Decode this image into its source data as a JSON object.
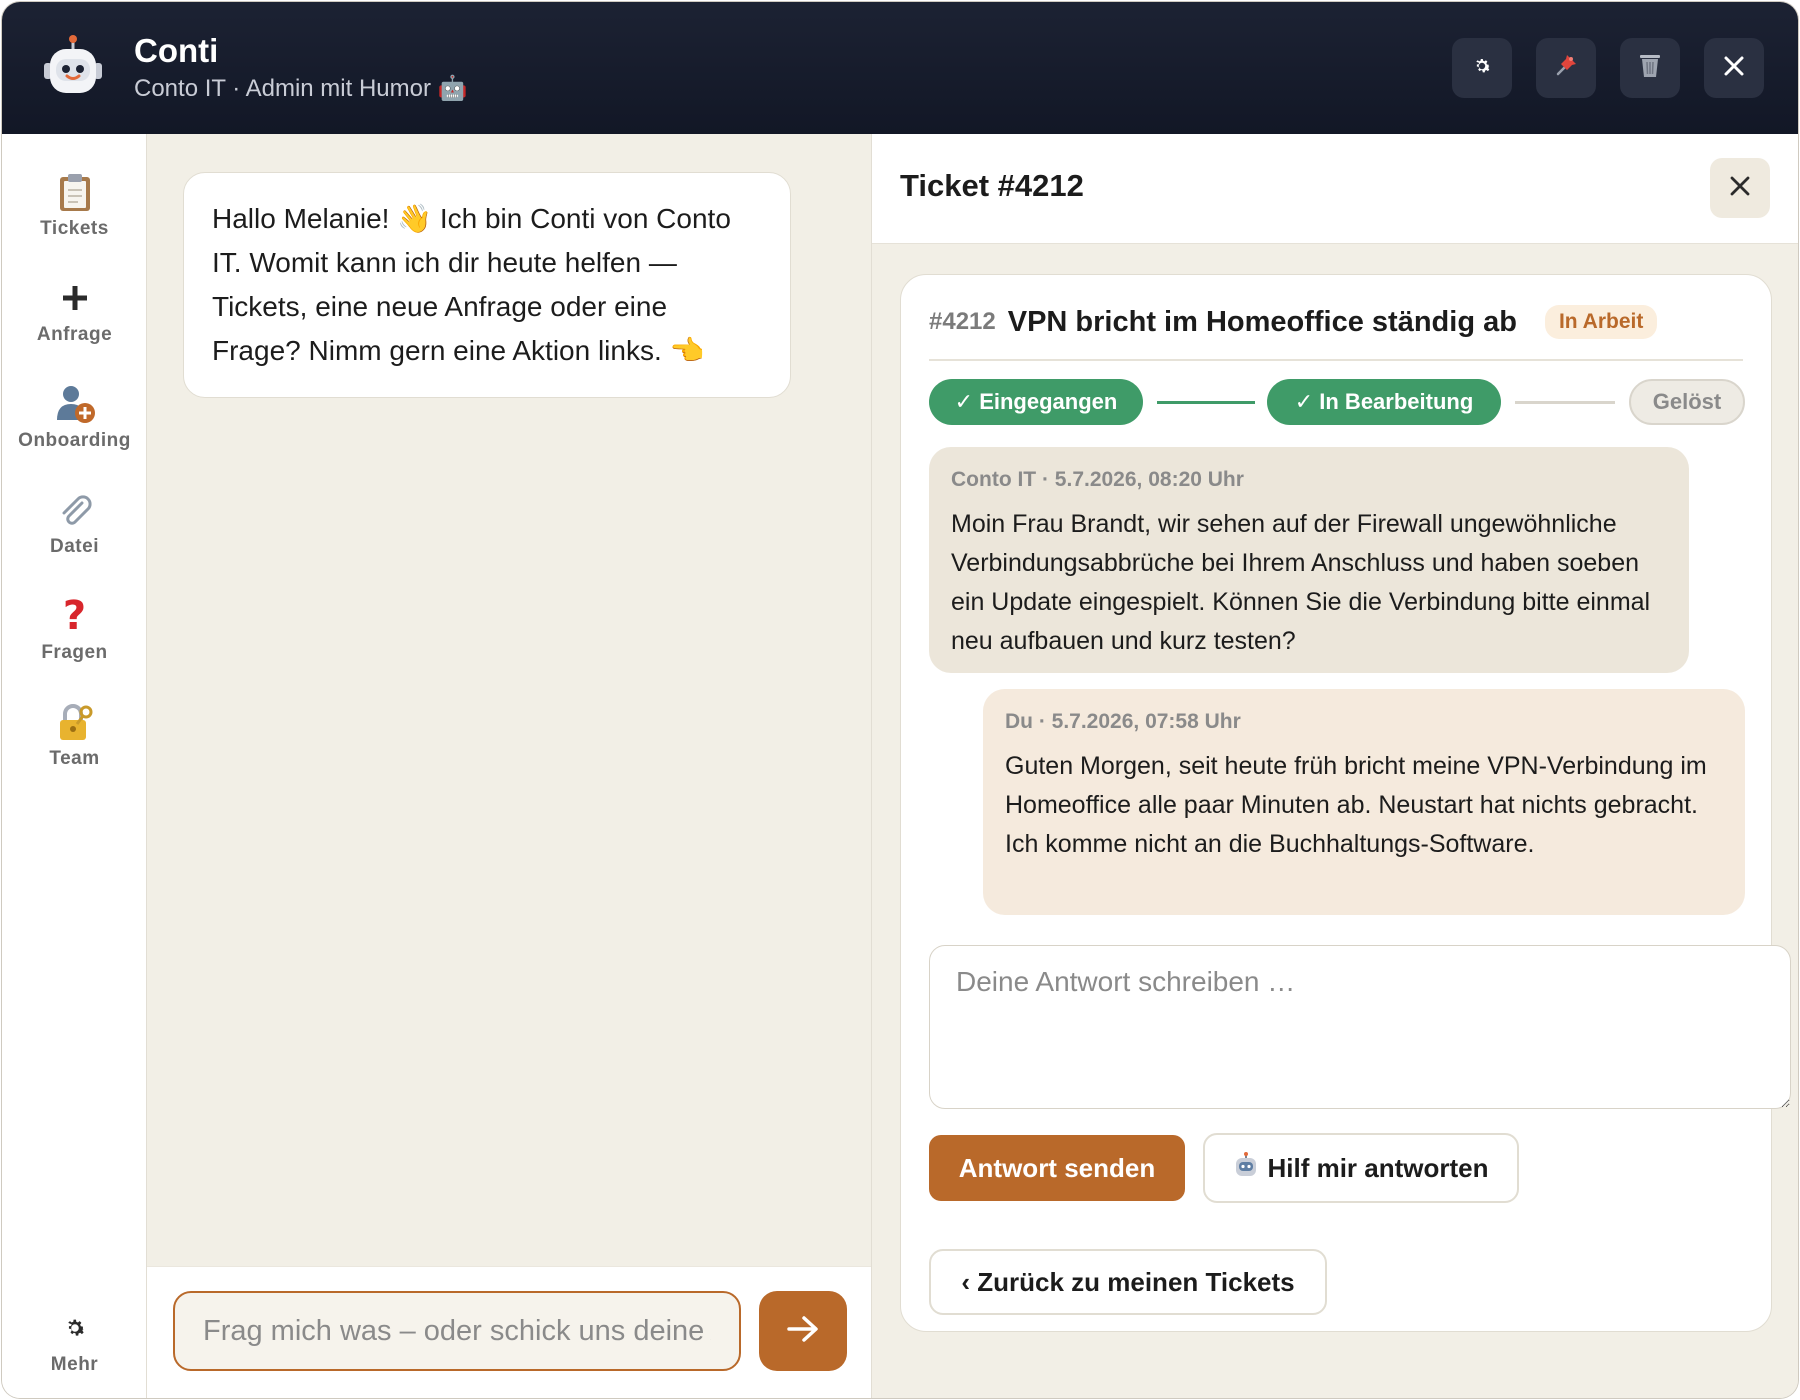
{
  "header": {
    "title": "Conti",
    "subtitle": "Conto IT · Admin mit Humor 🤖",
    "actions": [
      {
        "icon": "gear-icon"
      },
      {
        "icon": "pin-icon"
      },
      {
        "icon": "trash-icon"
      },
      {
        "icon": "close-icon"
      }
    ]
  },
  "sidebar": {
    "items": [
      {
        "label": "Tickets",
        "icon": "clipboard-icon"
      },
      {
        "label": "Anfrage",
        "icon": "plus-icon"
      },
      {
        "label": "Onboarding",
        "icon": "user-add-icon"
      },
      {
        "label": "Datei",
        "icon": "paperclip-icon"
      },
      {
        "label": "Fragen",
        "icon": "question-icon"
      },
      {
        "label": "Team",
        "icon": "lock-key-icon"
      }
    ],
    "more": {
      "label": "Mehr",
      "icon": "gear-icon"
    }
  },
  "chat": {
    "greeting": "Hallo Melanie! 👋 Ich bin Conti von Conto IT. Womit kann ich dir heute helfen — Tickets, eine neue Anfrage oder eine Frage? Nimm gern eine Aktion links. 👈",
    "input_placeholder": "Frag mich was – oder schick uns deine Anfrage …"
  },
  "ticket_panel": {
    "title": "Ticket #4212",
    "ticket": {
      "number": "#4212",
      "subject": "VPN bricht im Homeoffice ständig ab",
      "status": "In Arbeit",
      "progress": [
        {
          "label": "✓ Eingegangen",
          "done": true
        },
        {
          "label": "✓ In Bearbeitung",
          "done": true
        },
        {
          "label": "Gelöst",
          "done": false
        }
      ],
      "messages": [
        {
          "meta": "Conto IT · 5.7.2026, 08:20 Uhr",
          "text": "Moin Frau Brandt, wir sehen auf der Firewall ungewöhnliche Verbindungsabbrüche bei Ihrem Anschluss und haben soeben ein Update eingespielt. Können Sie die Verbindung bitte einmal neu aufbauen und kurz testen?"
        },
        {
          "meta": "Du · 5.7.2026, 07:58 Uhr",
          "text": "Guten Morgen, seit heute früh bricht meine VPN-Verbindung im Homeoffice alle paar Minuten ab. Neustart hat nichts gebracht. Ich komme nicht an die Buchhaltungs-Software."
        }
      ],
      "reply_placeholder": "Deine Antwort schreiben …",
      "send_label": "Antwort senden",
      "help_label": "Hilf mir antworten",
      "back_label": "‹ Zurück zu meinen Tickets"
    }
  },
  "colors": {
    "header_bg": "#161b2b",
    "accent": "#b9692a",
    "success": "#3f9b68",
    "background": "#f2efe6"
  }
}
